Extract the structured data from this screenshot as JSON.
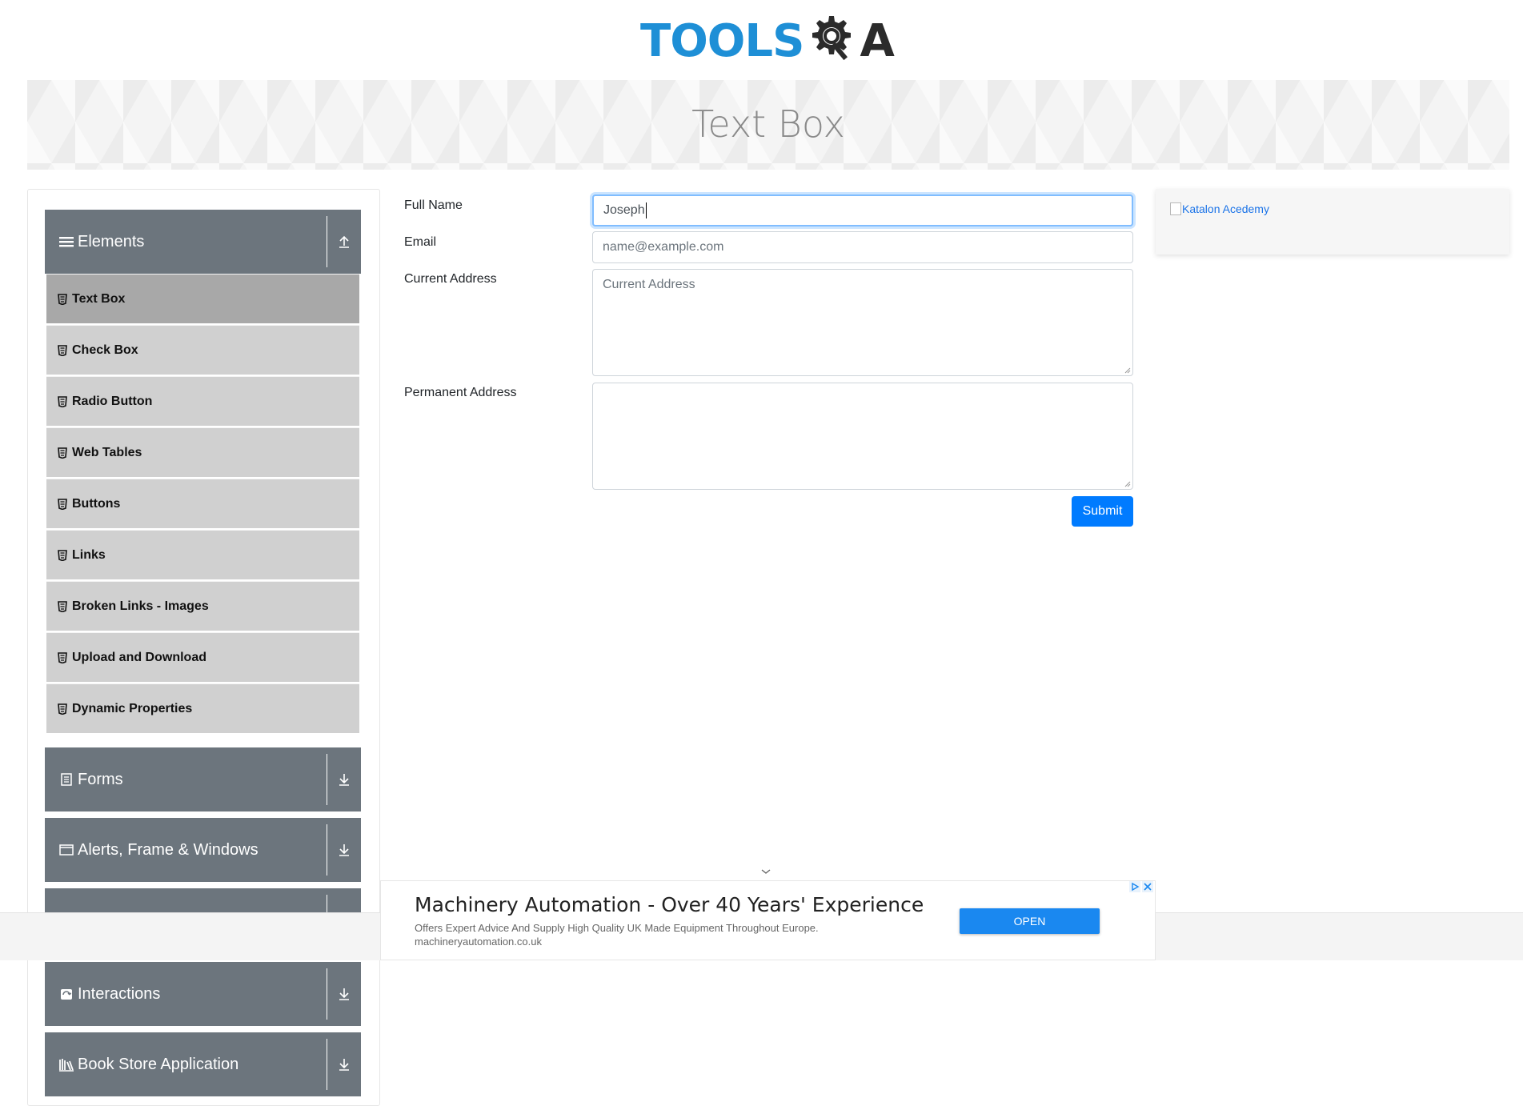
{
  "header": {
    "logo_tools": "TOOLS",
    "logo_q_suffix": "A"
  },
  "banner": {
    "title": "Text Box"
  },
  "sidebar": {
    "groups": [
      {
        "label": "Elements",
        "icon": "hamburger-icon",
        "toggle": "collapse-up-icon"
      },
      {
        "label": "Forms",
        "icon": "document-icon",
        "toggle": "expand-down-icon"
      },
      {
        "label": "Alerts, Frame & Windows",
        "icon": "window-icon",
        "toggle": "expand-down-icon"
      },
      {
        "label": "Interactions",
        "icon": "interactions-icon",
        "toggle": "expand-down-icon"
      },
      {
        "label": "Book Store Application",
        "icon": "bookshelf-icon",
        "toggle": "expand-down-icon"
      }
    ],
    "items": [
      {
        "label": "Text Box",
        "active": true
      },
      {
        "label": "Check Box"
      },
      {
        "label": "Radio Button"
      },
      {
        "label": "Web Tables"
      },
      {
        "label": "Buttons"
      },
      {
        "label": "Links"
      },
      {
        "label": "Broken Links - Images"
      },
      {
        "label": "Upload and Download"
      },
      {
        "label": "Dynamic Properties"
      }
    ]
  },
  "form": {
    "full_name_label": "Full Name",
    "full_name_value": "Joseph",
    "email_label": "Email",
    "email_placeholder": "name@example.com",
    "current_address_label": "Current Address",
    "current_address_placeholder": "Current Address",
    "permanent_address_label": "Permanent Address",
    "submit_label": "Submit"
  },
  "right_ad": {
    "alt_text": "Katalon Acedemy"
  },
  "bottom_ad": {
    "title": "Machinery Automation - Over 40 Years' Experience",
    "description": "Offers Expert Advice And Supply High Quality UK Made Equipment Throughout Europe.",
    "url": "machineryautomation.co.uk",
    "cta": "OPEN"
  },
  "colors": {
    "accent": "#007bff",
    "sidebar_header": "#6c757d",
    "sidebar_item": "#d0d0d0",
    "sidebar_item_active": "#a8a8a8",
    "logo_blue": "#1e8fd6"
  }
}
